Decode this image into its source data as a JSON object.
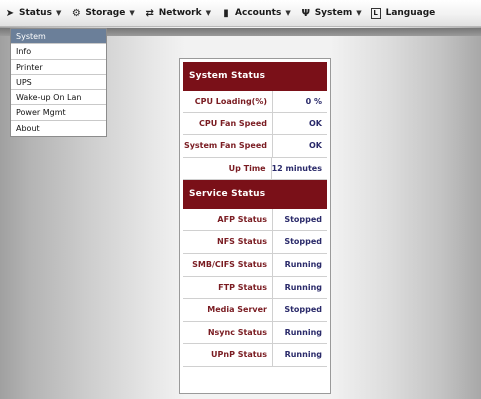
{
  "menubar": {
    "items": [
      {
        "label": "Status",
        "icon": "status-wrench-icon"
      },
      {
        "label": "Storage",
        "icon": "storage-gear-icon"
      },
      {
        "label": "Network",
        "icon": "network-icon"
      },
      {
        "label": "Accounts",
        "icon": "accounts-icon"
      },
      {
        "label": "System",
        "icon": "system-wrench-icon"
      },
      {
        "label": "Language",
        "icon": "language-icon"
      }
    ]
  },
  "dropdown": {
    "items": [
      "System",
      "Info",
      "Printer",
      "UPS",
      "Wake-up On Lan",
      "Power Mgmt",
      "About"
    ],
    "active_index": 0
  },
  "system_status": {
    "title": "System Status",
    "rows": [
      {
        "label": "CPU Loading(%)",
        "value": "0 %"
      },
      {
        "label": "CPU Fan Speed",
        "value": "OK"
      },
      {
        "label": "System Fan Speed",
        "value": "OK"
      },
      {
        "label": "Up Time",
        "value": "12 minutes"
      }
    ]
  },
  "service_status": {
    "title": "Service Status",
    "rows": [
      {
        "label": "AFP Status",
        "value": "Stopped"
      },
      {
        "label": "NFS Status",
        "value": "Stopped"
      },
      {
        "label": "SMB/CIFS Status",
        "value": "Running"
      },
      {
        "label": "FTP Status",
        "value": "Running"
      },
      {
        "label": "Media Server",
        "value": "Stopped"
      },
      {
        "label": "Nsync Status",
        "value": "Running"
      },
      {
        "label": "UPnP Status",
        "value": "Running"
      }
    ]
  },
  "colors": {
    "header_bg": "#7a1018",
    "label_text": "#7a1c22",
    "value_text": "#2a2a6a",
    "active_menu_bg": "#6b7f99"
  }
}
